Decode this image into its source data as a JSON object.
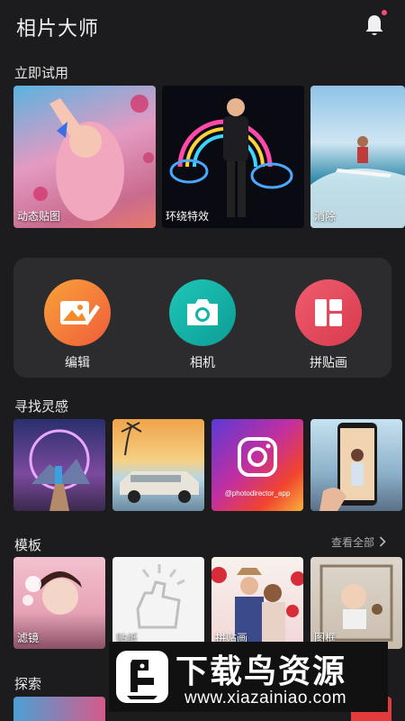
{
  "header": {
    "title": "相片大师",
    "bell_icon": "bell-icon",
    "accent": "#ff4d7a"
  },
  "try_now": {
    "title": "立即试用",
    "cards": [
      {
        "label": "动态贴图"
      },
      {
        "label": "环绕特效"
      },
      {
        "label": "消除"
      }
    ]
  },
  "tools": [
    {
      "label": "编辑",
      "icon": "photo-edit-icon",
      "color": "#f58a2b"
    },
    {
      "label": "相机",
      "icon": "camera-icon",
      "color": "#12b3a8"
    },
    {
      "label": "拼贴画",
      "icon": "collage-icon",
      "color": "#e8465a"
    }
  ],
  "inspiration": {
    "title": "寻找灵感",
    "cards": [
      {
        "caption": ""
      },
      {
        "caption": ""
      },
      {
        "caption": "@photodirector_app"
      },
      {
        "caption": ""
      }
    ]
  },
  "templates": {
    "title": "模板",
    "view_all": "查看全部",
    "cards": [
      {
        "label": "滤镜"
      },
      {
        "label": "贴纸"
      },
      {
        "label": "拼贴画"
      },
      {
        "label": "图框"
      }
    ]
  },
  "explore": {
    "title": "探索"
  },
  "watermark": {
    "title": "下载鸟资源",
    "url": "www.xiazainiao.com"
  }
}
